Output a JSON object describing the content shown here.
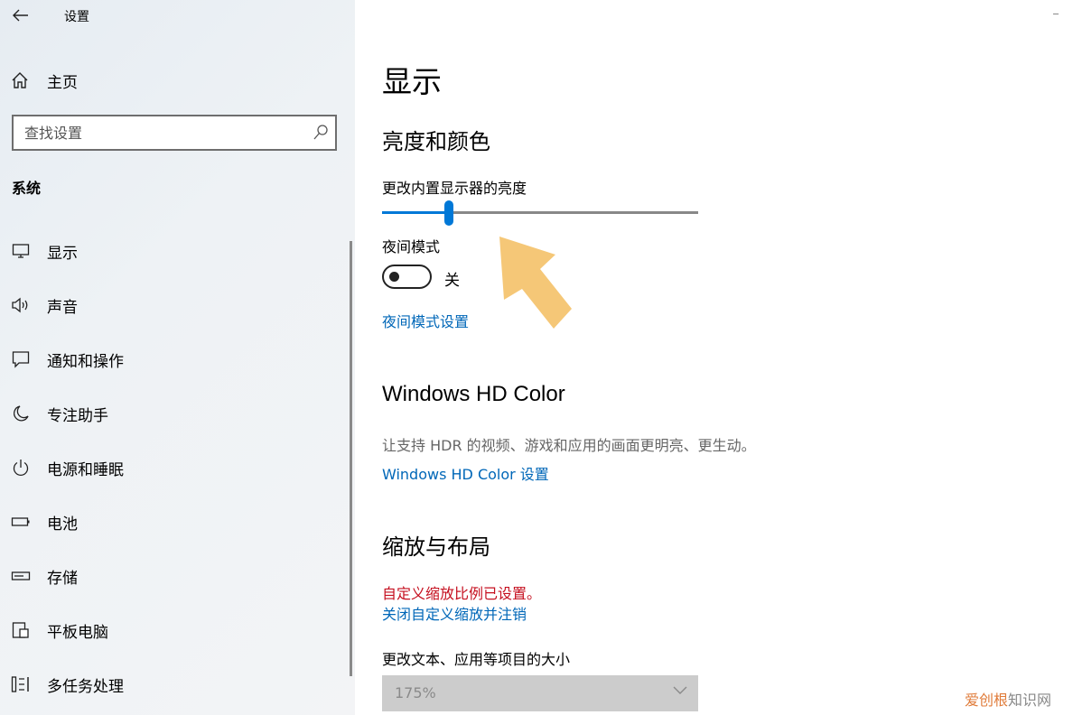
{
  "sidebar": {
    "app_title": "设置",
    "home_label": "主页",
    "search_placeholder": "查找设置",
    "section_title": "系统",
    "items": [
      {
        "label": "显示",
        "icon": "monitor-icon"
      },
      {
        "label": "声音",
        "icon": "speaker-icon"
      },
      {
        "label": "通知和操作",
        "icon": "notification-icon"
      },
      {
        "label": "专注助手",
        "icon": "moon-icon"
      },
      {
        "label": "电源和睡眠",
        "icon": "power-icon"
      },
      {
        "label": "电池",
        "icon": "battery-icon"
      },
      {
        "label": "存储",
        "icon": "storage-icon"
      },
      {
        "label": "平板电脑",
        "icon": "tablet-icon"
      },
      {
        "label": "多任务处理",
        "icon": "multitask-icon"
      }
    ]
  },
  "main": {
    "title": "显示",
    "brightness": {
      "heading": "亮度和颜色",
      "slider_label": "更改内置显示器的亮度",
      "slider_value": 0.21
    },
    "night_light": {
      "label": "夜间模式",
      "state_label": "关",
      "settings_link": "夜间模式设置"
    },
    "hd_color": {
      "heading": "Windows HD Color",
      "description": "让支持 HDR 的视频、游戏和应用的画面更明亮、更生动。",
      "link": "Windows HD Color 设置"
    },
    "scale": {
      "heading": "缩放与布局",
      "warning": "自定义缩放比例已设置。",
      "link": "关闭自定义缩放并注销",
      "size_label": "更改文本、应用等项目的大小",
      "size_value": "175%"
    }
  },
  "watermark": {
    "part1": "爱创根",
    "part2": "知识网"
  },
  "colors": {
    "accent": "#0078d7",
    "link": "#0067b8",
    "warning": "#c50f1f",
    "arrow": "#f4c26b"
  }
}
